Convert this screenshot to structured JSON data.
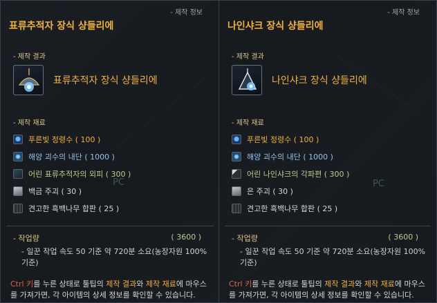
{
  "left": {
    "header_tag": "- 제작 정보",
    "title": "표류추적자 장식 샹들리에",
    "result_label": "- 제작 결과",
    "result_name": "표류추적자 장식 샹들리에",
    "materials_label": "- 제작 재료",
    "materials": [
      {
        "text": "푸른빛 정령수 ( 100 )",
        "color": "orange",
        "icon": "water-vial-icon"
      },
      {
        "text": "해양 괴수의 내단 ( 1000 )",
        "color": "blue",
        "icon": "sea-monster-core-icon"
      },
      {
        "text": "어린 표류추적자의 외피 ( 300 )",
        "color": "green",
        "icon": "hide-icon"
      },
      {
        "text": "백금 주괴 ( 30 )",
        "color": "white",
        "icon": "ingot-icon"
      },
      {
        "text": "견고한 흑백나무 합판 ( 25 )",
        "color": "white",
        "icon": "plank-icon"
      }
    ],
    "work_label": "- 작업량",
    "work_value": "( 3600 )",
    "work_desc": "- 일꾼 작업 속도 50 기준 약 720분 소요(농장자원 100% 기준)",
    "hint_key": "Ctrl 키",
    "hint_1": "를 누른 상태로 툴팁의 ",
    "hint_hl1": "제작 결과",
    "hint_2": "와 ",
    "hint_hl2": "제작 재료",
    "hint_3": "에 마우스를 가져가면, 각 아이템의 상세 정보를 확인할 수 있습니다.",
    "pc_mark": "PC"
  },
  "right": {
    "header_tag": "- 제작 정보",
    "title": "나인샤크 장식 샹들리에",
    "result_label": "- 제작 결과",
    "result_name": "나인샤크 장식 샹들리에",
    "materials_label": "- 제작 재료",
    "materials": [
      {
        "text": "푸른빛 정령수 ( 100 )",
        "color": "orange",
        "icon": "water-vial-icon"
      },
      {
        "text": "해양 괴수의 내단 ( 1000 )",
        "color": "blue",
        "icon": "sea-monster-core-icon"
      },
      {
        "text": "어린 나인샤크의 각파편 ( 300 )",
        "color": "green",
        "icon": "claw-fragment-icon"
      },
      {
        "text": "은 주괴 ( 30 )",
        "color": "white",
        "icon": "ingot-icon"
      },
      {
        "text": "견고한 흑백나무 합판 ( 25 )",
        "color": "white",
        "icon": "plank-icon"
      }
    ],
    "work_label": "- 작업량",
    "work_value": "( 3600 )",
    "work_desc": "- 일꾼 작업 속도 50 기준 약 720분 소요(농장자원 100% 기준)",
    "hint_key": "Ctrl 키",
    "hint_1": "를 누른 상태로 툴팁의 ",
    "hint_hl1": "제작 결과",
    "hint_2": "와 ",
    "hint_hl2": "제작 재료",
    "hint_3": "에 마우스를 가져가면, 각 아이템의 상세 정보를 확인할 수 있습니다.",
    "pc_mark": "PC"
  },
  "colors": {
    "title": "#f0b040",
    "orange": "#f0b040",
    "blue": "#8fc3ef",
    "green": "#b7d08a",
    "white": "#d4d7d9",
    "ctrl_key": "#e0604a"
  }
}
